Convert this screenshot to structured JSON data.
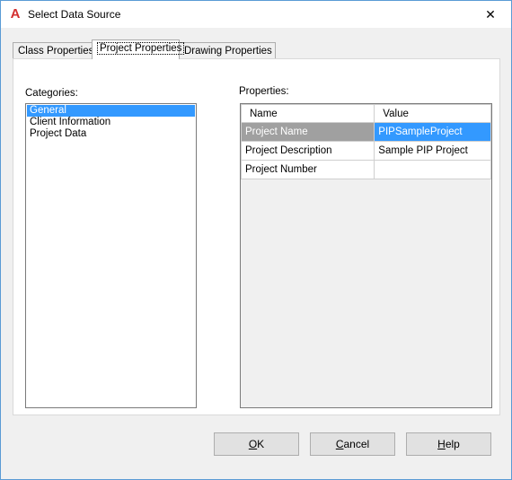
{
  "window": {
    "title": "Select Data Source",
    "app_icon": "A",
    "close_glyph": "✕"
  },
  "tabs": [
    {
      "label": "Class Properties"
    },
    {
      "label": "Project Properties"
    },
    {
      "label": "Drawing Properties"
    }
  ],
  "categories": {
    "label": "Categories:",
    "items": [
      "General",
      "Client Information",
      "Project Data"
    ]
  },
  "properties": {
    "label": "Properties:",
    "header": {
      "name": "Name",
      "value": "Value"
    },
    "rows": [
      {
        "name": "Project Name",
        "value": "PIPSampleProject"
      },
      {
        "name": "Project Description",
        "value": "Sample PIP Project"
      },
      {
        "name": "Project Number",
        "value": ""
      }
    ]
  },
  "buttons": {
    "ok": {
      "first": "O",
      "rest": "K"
    },
    "cancel": {
      "first": "C",
      "rest": "ancel"
    },
    "help": {
      "first": "H",
      "rest": "elp"
    }
  }
}
